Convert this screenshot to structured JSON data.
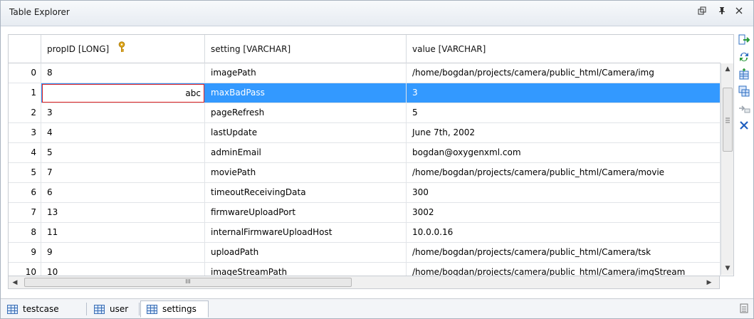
{
  "window": {
    "title": "Table Explorer"
  },
  "table": {
    "columns": [
      "",
      "propID [LONG]",
      "setting [VARCHAR]",
      "value [VARCHAR]"
    ],
    "rows": [
      {
        "index": "0",
        "propID": "8",
        "setting": "imagePath",
        "value": "/home/bogdan/projects/camera/public_html/Camera/img"
      },
      {
        "index": "1",
        "propID": "abc",
        "setting": "maxBadPass",
        "value": "3",
        "selected": true,
        "editing": true
      },
      {
        "index": "2",
        "propID": "3",
        "setting": "pageRefresh",
        "value": "5"
      },
      {
        "index": "3",
        "propID": "4",
        "setting": "lastUpdate",
        "value": "June 7th, 2002"
      },
      {
        "index": "4",
        "propID": "5",
        "setting": "adminEmail",
        "value": "bogdan@oxygenxml.com"
      },
      {
        "index": "5",
        "propID": "7",
        "setting": "moviePath",
        "value": "/home/bogdan/projects/camera/public_html/Camera/movie"
      },
      {
        "index": "6",
        "propID": "6",
        "setting": "timeoutReceivingData",
        "value": "300"
      },
      {
        "index": "7",
        "propID": "13",
        "setting": "firmwareUploadPort",
        "value": "3002"
      },
      {
        "index": "8",
        "propID": "11",
        "setting": "internalFirmwareUploadHost",
        "value": "10.0.0.16"
      },
      {
        "index": "9",
        "propID": "9",
        "setting": "uploadPath",
        "value": "/home/bogdan/projects/camera/public_html/Camera/tsk"
      },
      {
        "index": "10",
        "propID": "10",
        "setting": "imageStreamPath",
        "value": "/home/bogdan/projects/camera/public_html/Camera/imgStream"
      }
    ]
  },
  "scroll": {
    "h_thumb_glyph": "III"
  },
  "tabs": [
    {
      "label": "testcase",
      "active": false
    },
    {
      "label": "user",
      "active": false
    },
    {
      "label": "settings",
      "active": true
    }
  ],
  "icons": {
    "key": "key-icon",
    "export": "export-icon",
    "refresh": "refresh-icon",
    "insert_row": "insert-row-icon",
    "duplicate_row": "duplicate-row-icon",
    "commit": "commit-icon",
    "delete": "delete-icon"
  },
  "colors": {
    "selection": "#3399ff",
    "edit_border": "#e02020",
    "icon_blue": "#2f6fc2",
    "key_gold": "#e2a91a",
    "delete_blue": "#1f5fbf"
  }
}
